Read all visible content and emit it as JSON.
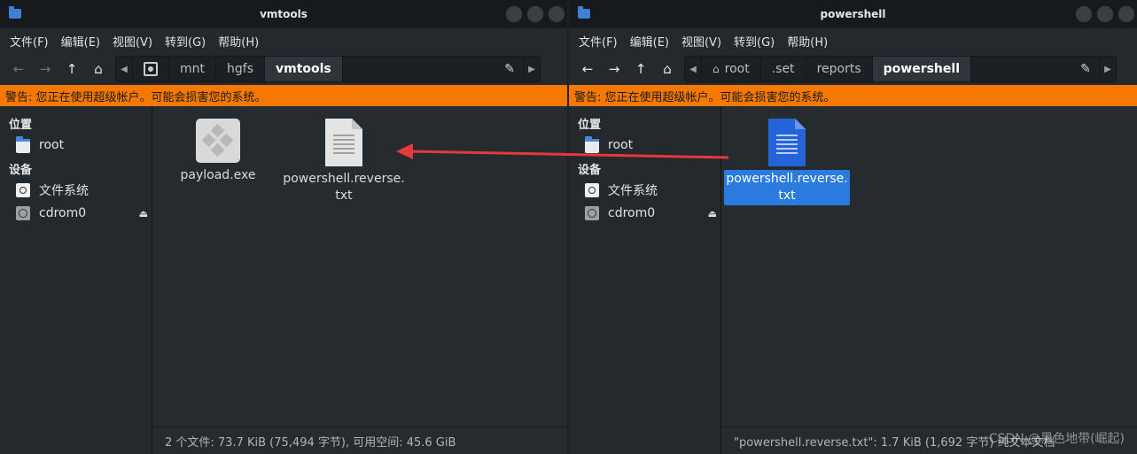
{
  "left_window": {
    "title": "vmtools",
    "menu": [
      "文件(F)",
      "编辑(E)",
      "视图(V)",
      "转到(G)",
      "帮助(H)"
    ],
    "path": [
      "mnt",
      "hgfs",
      "vmtools"
    ],
    "warning": "警告: 您正在使用超级帐户。可能会损害您的系统。",
    "sidebar": {
      "places_header": "位置",
      "places": [
        {
          "label": "root",
          "icon": "folder-icon"
        }
      ],
      "devices_header": "设备",
      "devices": [
        {
          "label": "文件系统",
          "icon": "drive-icon"
        },
        {
          "label": "cdrom0",
          "icon": "cd-icon",
          "eject": true
        }
      ]
    },
    "files": [
      {
        "label": "payload.exe",
        "icon": "exe-icon",
        "selected": false
      },
      {
        "label": "powershell.reverse.\ntxt",
        "icon": "text-file-icon",
        "selected": false
      }
    ],
    "status": "2 个文件: 73.7 KiB (75,494 字节), 可用空间: 45.6 GiB"
  },
  "right_window": {
    "title": "powershell",
    "menu": [
      "文件(F)",
      "编辑(E)",
      "视图(V)",
      "转到(G)",
      "帮助(H)"
    ],
    "path": [
      "root",
      ".set",
      "reports",
      "powershell"
    ],
    "warning": "警告: 您正在使用超级帐户。可能会损害您的系统。",
    "sidebar": {
      "places_header": "位置",
      "places": [
        {
          "label": "root",
          "icon": "folder-icon"
        }
      ],
      "devices_header": "设备",
      "devices": [
        {
          "label": "文件系统",
          "icon": "drive-icon"
        },
        {
          "label": "cdrom0",
          "icon": "cd-icon",
          "eject": true
        }
      ]
    },
    "files": [
      {
        "label": "powershell.reverse.\ntxt",
        "icon": "text-file-icon",
        "selected": true
      }
    ],
    "status": "\"powershell.reverse.txt\": 1.7 KiB (1,692 字节) 纯文本文档"
  },
  "watermark": "CSDN @黑色地带(崛起)",
  "colors": {
    "warning_bg": "#f57900",
    "selection": "#2b7bde",
    "arrow": "#e8383d"
  }
}
